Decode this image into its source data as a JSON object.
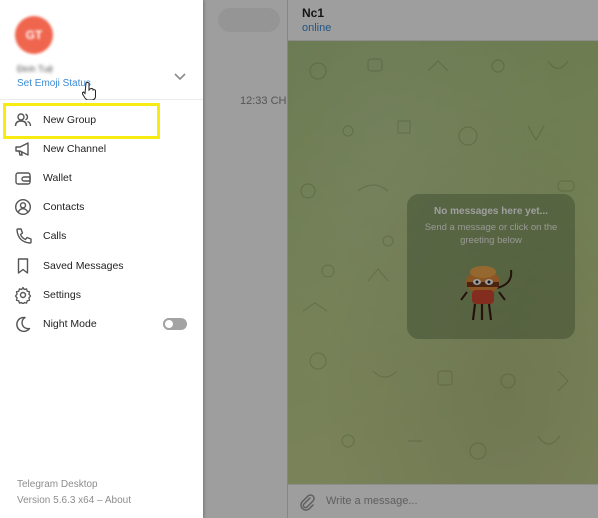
{
  "chat_list": {
    "time": "12:33 CH"
  },
  "chat": {
    "name": "Nc1",
    "status": "online",
    "empty_title": "No messages here yet...",
    "empty_subtitle": "Send a message or click on the greeting below",
    "composer_placeholder": "Write a message..."
  },
  "menu": {
    "user": {
      "avatar_initials": "GT",
      "name": "Đinh Tuệ",
      "emoji_status": "Set Emoji Status",
      "avatar_color": "#f0654e"
    },
    "items": [
      {
        "label": "New Group",
        "icon": "group-icon"
      },
      {
        "label": "New Channel",
        "icon": "megaphone-icon"
      },
      {
        "label": "Wallet",
        "icon": "wallet-icon"
      },
      {
        "label": "Contacts",
        "icon": "contact-icon"
      },
      {
        "label": "Calls",
        "icon": "phone-icon"
      },
      {
        "label": "Saved Messages",
        "icon": "bookmark-icon"
      },
      {
        "label": "Settings",
        "icon": "gear-icon"
      },
      {
        "label": "Night Mode",
        "icon": "moon-icon"
      }
    ],
    "night_mode_on": false,
    "highlight_color": "#f7ec12",
    "footer": {
      "app_name": "Telegram Desktop",
      "version": "Version 5.6.3 x64 – About"
    }
  }
}
